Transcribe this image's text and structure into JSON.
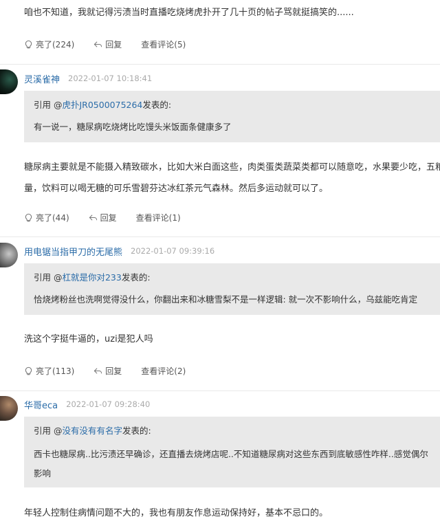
{
  "post0": {
    "text": "咱也不知道，我就记得污渍当时直播吃烧烤虎扑开了几十页的帖子骂就挺搞笑的......",
    "actions": {
      "like": "亮了(224)",
      "reply": "回复",
      "view": "查看评论(5)"
    }
  },
  "post1": {
    "username": "灵溪雀神",
    "timestamp": "2022-01-07 10:18:41",
    "quote": {
      "prefix": "引用 @",
      "user": "虎扑JR0500075264",
      "suffix": "发表的:",
      "text": "有一说一，糖尿病吃烧烤比吃馒头米饭面条健康多了"
    },
    "body": "糖尿病主要就是不能摄入精致碳水，比如大米白面这些，肉类蛋类蔬菜类都可以随意吃，水果要少吃，五粮适量，饮料可以喝无糖的可乐雪碧芬达冰红茶元气森林。然后多运动就可以了。",
    "actions": {
      "like": "亮了(44)",
      "reply": "回复",
      "view": "查看评论(1)"
    }
  },
  "post2": {
    "username": "用电锯当指甲刀的无尾熊",
    "timestamp": "2022-01-07 09:39:16",
    "quote": {
      "prefix": "引用 @",
      "user": "杠就是你对233",
      "suffix": "发表的:",
      "text": "恰烧烤粉丝也洗啊觉得没什么，你翻出来和冰糖雪梨不是一样逻辑: 就一次不影响什么，乌兹能吃肯定"
    },
    "body": "洗这个字挺牛逼的，uzi是犯人吗",
    "actions": {
      "like": "亮了(113)",
      "reply": "回复",
      "view": "查看评论(2)"
    }
  },
  "post3": {
    "username": "华哥eca",
    "timestamp": "2022-01-07 09:28:40",
    "quote": {
      "prefix": "引用 @",
      "user": "没有没有有名字",
      "suffix": "发表的:",
      "text": "西卡也糖尿病..比污渍还早确诊，还直播去烧烤店呢..不知道糖尿病对这些东西到底敏感性咋样..感觉偶尔",
      "text2": "影响"
    },
    "body": "年轻人控制住病情问题不大的，我也有朋友作息运动保持好，基本不忌口的。"
  },
  "colors": {
    "link": "#2b6ca8",
    "quote_bg": "#e9e9e9",
    "divider": "#e9e9e9"
  }
}
